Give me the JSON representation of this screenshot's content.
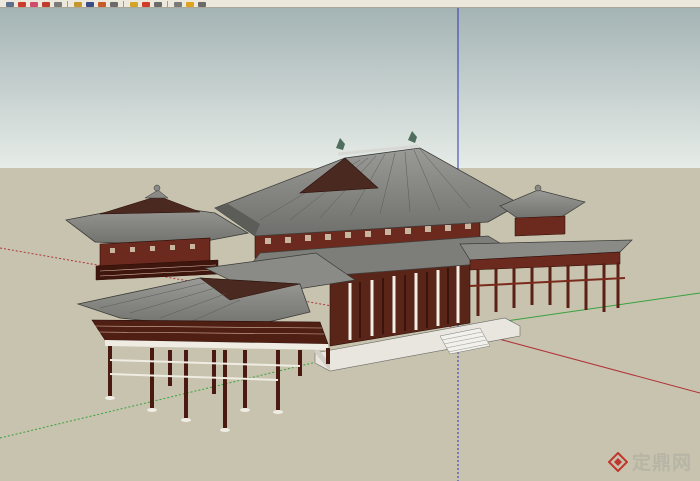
{
  "toolbar": {
    "buttons": [
      {
        "icon": "select-icon",
        "color": "#5b6f8c"
      },
      {
        "icon": "paint-bucket-icon",
        "color": "#cc3a2b"
      },
      {
        "icon": "eraser-icon",
        "color": "#d24b6a"
      },
      {
        "icon": "rectangle-icon",
        "color": "#c23a2e"
      },
      {
        "icon": "line-icon",
        "color": "#7a7a7a"
      },
      {
        "icon": "push-pull-icon",
        "color": "#c6952b"
      },
      {
        "icon": "move-icon",
        "color": "#3a4b86"
      },
      {
        "icon": "rotate-icon",
        "color": "#c85a2a"
      },
      {
        "icon": "offset-icon",
        "color": "#6b6b6b"
      },
      {
        "icon": "tape-measure-icon",
        "color": "#d0a52a"
      },
      {
        "icon": "orbit-icon",
        "color": "#d23a2a"
      },
      {
        "icon": "pan-icon",
        "color": "#6a6a6a"
      },
      {
        "icon": "zoom-icon",
        "color": "#7a7a7a"
      },
      {
        "icon": "zoom-extents-icon",
        "color": "#e0a321"
      },
      {
        "icon": "walk-icon",
        "color": "#6a6a6a"
      }
    ]
  },
  "scene": {
    "sky_top": "#a4b4b4",
    "sky_bottom": "#e6ece8",
    "ground": "#c8c3ae",
    "axis_blue": "#2e35b8",
    "axis_red": "#b0343a",
    "axis_green": "#36a23f",
    "roof": "#7f7f7c",
    "timber": "#4f1f14"
  },
  "watermark": {
    "text": "定鼎网",
    "logo_color": "#c0362c"
  }
}
